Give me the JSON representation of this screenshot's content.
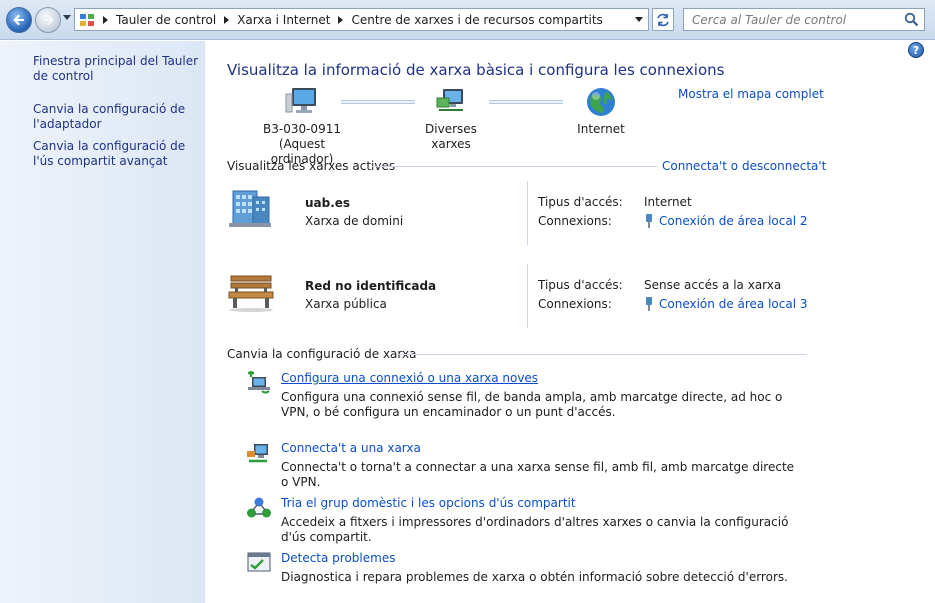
{
  "address_bar": {
    "breadcrumbs": [
      "Tauler de control",
      "Xarxa i Internet",
      "Centre de xarxes i de recursos compartits"
    ],
    "search_placeholder": "Cerca al Tauler de control"
  },
  "sidebar": {
    "links": [
      {
        "label": "Finestra principal del Tauler de control"
      },
      {
        "label": "Canvia la configuració de l'adaptador"
      },
      {
        "label": "Canvia la configuració de l'ús compartit avançat"
      }
    ]
  },
  "main": {
    "title": "Visualitza la informació de xarxa bàsica i configura les connexions",
    "full_map_link": "Mostra el mapa complet",
    "map": {
      "computer_name": "B3-030-0911",
      "computer_sub": "(Aquest ordinador)",
      "network": "Diverses xarxes",
      "internet": "Internet"
    },
    "active_networks": {
      "heading": "Visualitza les xarxes actives",
      "connect_link": "Connecta't o desconnecta't",
      "networks": [
        {
          "name": "uab.es",
          "type": "Xarxa de domini",
          "access_label": "Tipus d'accés:",
          "access_value": "Internet",
          "connections_label": "Connexions:",
          "connection": "Conexión de área local 2"
        },
        {
          "name": "Red no identificada",
          "type": "Xarxa pública",
          "access_label": "Tipus d'accés:",
          "access_value": "Sense accés a la xarxa",
          "connections_label": "Connexions:",
          "connection": "Conexión de área local 3"
        }
      ]
    },
    "change_settings": {
      "heading": "Canvia la configuració de xarxa",
      "tasks": [
        {
          "title": "Configura una connexió o una xarxa noves",
          "description": "Configura una connexió sense fil, de banda ampla, amb marcatge directe, ad hoc o VPN, o bé configura un encaminador o un punt d'accés."
        },
        {
          "title": "Connecta't a una xarxa",
          "description": "Connecta't o torna't a connectar a una xarxa sense fil, amb fil, amb marcatge directe o VPN."
        },
        {
          "title": "Tria el grup domèstic i les opcions d'ús compartit",
          "description": "Accedeix a fitxers i impressores d'ordinadors d'altres xarxes o canvia la configuració d'ús compartit."
        },
        {
          "title": "Detecta problemes",
          "description": "Diagnostica i repara problemes de xarxa o obtén informació sobre detecció d'errors."
        }
      ]
    }
  }
}
